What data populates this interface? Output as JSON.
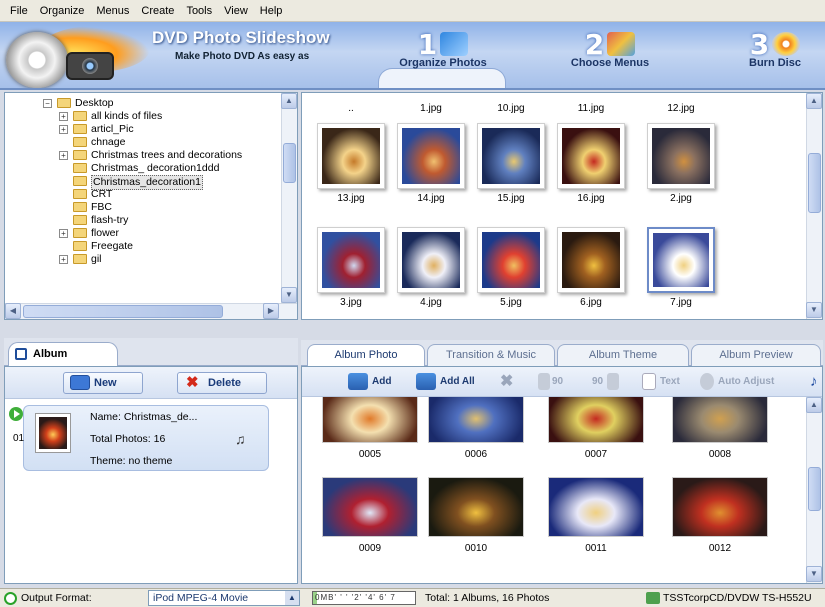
{
  "menu": [
    "File",
    "Organize",
    "Menus",
    "Create",
    "Tools",
    "View",
    "Help"
  ],
  "banner": {
    "title": "DVD Photo Slideshow",
    "subtitle": "Make Photo DVD As easy as",
    "steps": [
      {
        "number": "1",
        "label": "Organize Photos",
        "active": true
      },
      {
        "number": "2",
        "label": "Choose Menus",
        "active": false
      },
      {
        "number": "3",
        "label": "Burn Disc",
        "active": false
      }
    ]
  },
  "tree": {
    "items": [
      {
        "label": "Desktop",
        "level": 0,
        "expander": "minus"
      },
      {
        "label": "all kinds of files",
        "level": 1,
        "expander": "plus"
      },
      {
        "label": "articl_Pic",
        "level": 1,
        "expander": "plus"
      },
      {
        "label": "chnage",
        "level": 1,
        "expander": ""
      },
      {
        "label": "Christmas trees and  decorations",
        "level": 1,
        "expander": "plus"
      },
      {
        "label": "Christmas_ decoration1ddd",
        "level": 1,
        "expander": ""
      },
      {
        "label": "Christmas_decoration1",
        "level": 1,
        "expander": "",
        "selected": true
      },
      {
        "label": "CRT",
        "level": 1,
        "expander": ""
      },
      {
        "label": "FBC",
        "level": 1,
        "expander": ""
      },
      {
        "label": "flash-try",
        "level": 1,
        "expander": ""
      },
      {
        "label": "flower",
        "level": 1,
        "expander": "plus"
      },
      {
        "label": "Freegate",
        "level": 1,
        "expander": ""
      },
      {
        "label": "gil",
        "level": 1,
        "expander": "plus"
      }
    ]
  },
  "photos": {
    "top_row": [
      "..",
      "1.jpg",
      "10.jpg",
      "11.jpg",
      "12.jpg"
    ],
    "rows": [
      [
        {
          "name": "13.jpg",
          "palette": [
            "#3a2718",
            "#c47a2a",
            "#f4d38a"
          ]
        },
        {
          "name": "14.jpg",
          "palette": [
            "#2a4a9a",
            "#f0c070",
            "#c05a30"
          ]
        },
        {
          "name": "15.jpg",
          "palette": [
            "#1a2a58",
            "#e8c870",
            "#6080c0"
          ]
        },
        {
          "name": "16.jpg",
          "palette": [
            "#3a1010",
            "#c42a20",
            "#f0d070"
          ]
        },
        {
          "name": "2.jpg",
          "palette": [
            "#2a2a3a",
            "#d09040",
            "#8a7060"
          ]
        }
      ],
      [
        {
          "name": "3.jpg",
          "palette": [
            "#3050a0",
            "#d0d8f0",
            "#a02030"
          ]
        },
        {
          "name": "4.jpg",
          "palette": [
            "#1a2a5a",
            "#e0b060",
            "#f0f0f8"
          ]
        },
        {
          "name": "5.jpg",
          "palette": [
            "#1c3a8a",
            "#f0c060",
            "#e04030"
          ]
        },
        {
          "name": "6.jpg",
          "palette": [
            "#2a1a10",
            "#f0c040",
            "#a06020"
          ]
        },
        {
          "name": "7.jpg",
          "palette": [
            "#3a4a9a",
            "#f0d080",
            "#ffffff"
          ],
          "selected": true
        }
      ]
    ]
  },
  "album_panel": {
    "tab_label": "Album",
    "new_label": "New",
    "delete_label": "Delete",
    "album": {
      "index": "01",
      "name": "Name: Christmas_de...",
      "total": "Total Photos: 16",
      "theme": "Theme: no theme"
    }
  },
  "right_tabs": [
    "Album Photo",
    "Transition & Music",
    "Album Theme",
    "Album Preview"
  ],
  "photo_toolbar": {
    "add": "Add",
    "add_all": "Add All",
    "rotate_left": "90",
    "rotate_right": "90",
    "text": "Text",
    "auto_adjust": "Auto Adjust"
  },
  "album_photos": [
    {
      "label": "0005",
      "palette": [
        "#5a2a18",
        "#e07a2a",
        "#f4e0b0"
      ]
    },
    {
      "label": "0006",
      "palette": [
        "#1a2a6a",
        "#e0c070",
        "#5070c0"
      ]
    },
    {
      "label": "0007",
      "palette": [
        "#3a1010",
        "#c42a20",
        "#e0d060"
      ]
    },
    {
      "label": "0008",
      "palette": [
        "#2a2a3a",
        "#d0a050",
        "#9a8a70"
      ]
    },
    {
      "label": "0009",
      "palette": [
        "#2a3a7a",
        "#e0e8f8",
        "#b02030"
      ]
    },
    {
      "label": "0010",
      "palette": [
        "#1a1a10",
        "#f0c040",
        "#805020"
      ]
    },
    {
      "label": "0011",
      "palette": [
        "#1a2a7a",
        "#f0d080",
        "#e8e8f8"
      ]
    },
    {
      "label": "0012",
      "palette": [
        "#2a1a18",
        "#e09030",
        "#c03020"
      ]
    }
  ],
  "status": {
    "output_label": "Output Format:",
    "output_value": "iPod MPEG-4 Movie",
    "capacity_ticks": "0MB' ' ' '2' '4' 6' 7",
    "capacity_fill": 0.04,
    "total": "Total: 1 Albums, 16 Photos",
    "drive": "TSSTcorpCD/DVDW TS-H552U"
  }
}
